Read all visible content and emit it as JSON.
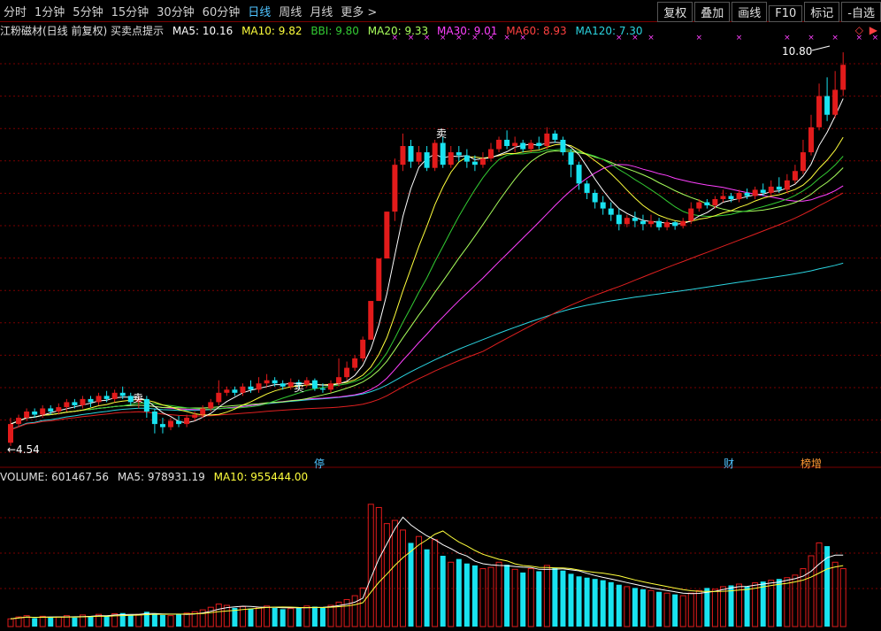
{
  "toolbar": {
    "periods": [
      "分时",
      "1分钟",
      "5分钟",
      "15分钟",
      "30分钟",
      "60分钟",
      "日线",
      "周线",
      "月线",
      "更多 >"
    ],
    "active_period": "日线",
    "buttons": [
      "复权",
      "叠加",
      "画线",
      "F10",
      "标记",
      "-自选"
    ]
  },
  "info": {
    "title": "江粉磁材(日线 前复权) 买卖点提示",
    "ma5": "MA5: 10.16",
    "ma10": "MA10: 9.82",
    "bbi": "BBI: 9.80",
    "ma20": "MA20: 9.33",
    "ma30": "MA30: 9.01",
    "ma60": "MA60: 8.93",
    "ma120": "MA120: 7.30"
  },
  "volume_info": {
    "volume": "VOLUME: 601467.56",
    "ma5": "MA5: 978931.19",
    "ma10": "MA10: 955444.00"
  },
  "colors": {
    "up": "#e21b1b",
    "down": "#19e3f0",
    "ma5": "#ffffff",
    "ma10": "#ffff3c",
    "bbi": "#33cc33",
    "ma20": "#a8ff5c",
    "ma30": "#ff40ff",
    "ma60": "#e02020",
    "ma120": "#2bd4e0",
    "grid": "#7a0000",
    "marker": "#ff40ff"
  },
  "markers": {
    "high_label": "10.80",
    "low_label": "4.54",
    "sell_labels": [
      "卖",
      "卖",
      "卖"
    ],
    "event_labels": [
      "停",
      "财",
      "榜增"
    ]
  },
  "chart_data": {
    "type": "candlestick",
    "title": "江粉磁材(日线 前复权)",
    "price_range": [
      4.2,
      11.0
    ],
    "high": 10.8,
    "low": 4.54,
    "candles": [
      [
        4.55,
        4.85,
        4.5,
        4.95
      ],
      [
        4.85,
        4.95,
        4.8,
        5.0
      ],
      [
        4.95,
        5.05,
        4.9,
        5.1
      ],
      [
        5.05,
        5.0,
        4.95,
        5.1
      ],
      [
        5.0,
        5.1,
        4.95,
        5.15
      ],
      [
        5.1,
        5.05,
        5.0,
        5.15
      ],
      [
        5.05,
        5.12,
        5.0,
        5.18
      ],
      [
        5.12,
        5.2,
        5.05,
        5.25
      ],
      [
        5.2,
        5.15,
        5.1,
        5.25
      ],
      [
        5.15,
        5.25,
        5.1,
        5.3
      ],
      [
        5.25,
        5.2,
        5.12,
        5.3
      ],
      [
        5.2,
        5.3,
        5.15,
        5.35
      ],
      [
        5.3,
        5.25,
        5.2,
        5.38
      ],
      [
        5.25,
        5.35,
        5.2,
        5.4
      ],
      [
        5.35,
        5.3,
        5.25,
        5.45
      ],
      [
        5.3,
        5.2,
        5.15,
        5.35
      ],
      [
        5.2,
        5.25,
        5.1,
        5.3
      ],
      [
        5.25,
        5.05,
        4.95,
        5.3
      ],
      [
        5.05,
        4.85,
        4.7,
        5.1
      ],
      [
        4.85,
        4.8,
        4.7,
        4.95
      ],
      [
        4.8,
        4.9,
        4.75,
        4.95
      ],
      [
        4.9,
        4.85,
        4.8,
        4.98
      ],
      [
        4.85,
        4.95,
        4.8,
        5.0
      ],
      [
        4.95,
        5.0,
        4.9,
        5.05
      ],
      [
        5.0,
        5.1,
        4.95,
        5.15
      ],
      [
        5.1,
        5.2,
        5.05,
        5.25
      ],
      [
        5.2,
        5.35,
        5.15,
        5.55
      ],
      [
        5.35,
        5.4,
        5.3,
        5.45
      ],
      [
        5.4,
        5.35,
        5.3,
        5.45
      ],
      [
        5.35,
        5.45,
        5.3,
        5.5
      ],
      [
        5.45,
        5.4,
        5.35,
        5.55
      ],
      [
        5.4,
        5.5,
        5.35,
        5.6
      ],
      [
        5.5,
        5.55,
        5.45,
        5.65
      ],
      [
        5.55,
        5.5,
        5.45,
        5.6
      ],
      [
        5.5,
        5.45,
        5.4,
        5.55
      ],
      [
        5.45,
        5.52,
        5.4,
        5.58
      ],
      [
        5.52,
        5.48,
        5.42,
        5.56
      ],
      [
        5.48,
        5.55,
        5.44,
        5.6
      ],
      [
        5.55,
        5.42,
        5.38,
        5.58
      ],
      [
        5.42,
        5.4,
        5.35,
        5.5
      ],
      [
        5.4,
        5.5,
        5.35,
        5.55
      ],
      [
        5.5,
        5.6,
        5.45,
        5.9
      ],
      [
        5.6,
        5.75,
        5.55,
        5.85
      ],
      [
        5.75,
        5.9,
        5.7,
        5.95
      ],
      [
        5.9,
        6.2,
        5.85,
        6.25
      ],
      [
        6.2,
        6.82,
        6.2,
        6.82
      ],
      [
        6.82,
        7.5,
        6.82,
        7.5
      ],
      [
        7.5,
        8.25,
        7.5,
        8.25
      ],
      [
        8.25,
        9.0,
        8.1,
        9.1
      ],
      [
        9.0,
        9.3,
        8.9,
        9.5
      ],
      [
        9.3,
        9.05,
        8.95,
        9.4
      ],
      [
        9.05,
        9.2,
        9.0,
        9.3
      ],
      [
        9.2,
        8.95,
        8.9,
        9.3
      ],
      [
        8.95,
        9.35,
        8.9,
        9.4
      ],
      [
        9.35,
        9.0,
        8.95,
        9.45
      ],
      [
        9.0,
        9.2,
        8.95,
        9.3
      ],
      [
        9.2,
        9.15,
        9.05,
        9.3
      ],
      [
        9.15,
        9.05,
        8.95,
        9.25
      ],
      [
        9.05,
        9.0,
        8.9,
        9.15
      ],
      [
        9.0,
        9.1,
        8.95,
        9.2
      ],
      [
        9.1,
        9.25,
        9.05,
        9.35
      ],
      [
        9.25,
        9.4,
        9.2,
        9.45
      ],
      [
        9.4,
        9.3,
        9.25,
        9.55
      ],
      [
        9.3,
        9.35,
        9.2,
        9.45
      ],
      [
        9.35,
        9.25,
        9.2,
        9.4
      ],
      [
        9.25,
        9.35,
        9.2,
        9.4
      ],
      [
        9.35,
        9.3,
        9.25,
        9.45
      ],
      [
        9.3,
        9.5,
        9.25,
        9.6
      ],
      [
        9.5,
        9.4,
        9.35,
        9.55
      ],
      [
        9.4,
        9.2,
        9.15,
        9.45
      ],
      [
        9.2,
        9.0,
        8.8,
        9.25
      ],
      [
        9.0,
        8.7,
        8.6,
        9.05
      ],
      [
        8.7,
        8.55,
        8.45,
        8.75
      ],
      [
        8.55,
        8.4,
        8.3,
        8.6
      ],
      [
        8.4,
        8.3,
        8.2,
        8.5
      ],
      [
        8.3,
        8.2,
        8.1,
        8.4
      ],
      [
        8.2,
        8.05,
        7.95,
        8.3
      ],
      [
        8.05,
        8.15,
        8.0,
        8.2
      ],
      [
        8.15,
        8.1,
        8.0,
        8.25
      ],
      [
        8.1,
        8.05,
        7.95,
        8.2
      ],
      [
        8.05,
        8.1,
        8.0,
        8.2
      ],
      [
        8.1,
        8.0,
        7.95,
        8.15
      ],
      [
        8.0,
        8.08,
        7.95,
        8.12
      ],
      [
        8.08,
        8.02,
        7.96,
        8.1
      ],
      [
        8.02,
        8.1,
        7.98,
        8.15
      ],
      [
        8.1,
        8.3,
        8.05,
        8.4
      ],
      [
        8.3,
        8.4,
        8.25,
        8.45
      ],
      [
        8.4,
        8.35,
        8.3,
        8.45
      ],
      [
        8.35,
        8.45,
        8.3,
        8.5
      ],
      [
        8.45,
        8.5,
        8.4,
        8.6
      ],
      [
        8.5,
        8.45,
        8.4,
        8.55
      ],
      [
        8.45,
        8.55,
        8.4,
        8.6
      ],
      [
        8.55,
        8.5,
        8.45,
        8.62
      ],
      [
        8.5,
        8.6,
        8.45,
        8.65
      ],
      [
        8.6,
        8.55,
        8.5,
        8.7
      ],
      [
        8.55,
        8.65,
        8.5,
        8.75
      ],
      [
        8.65,
        8.6,
        8.55,
        8.8
      ],
      [
        8.6,
        8.75,
        8.55,
        8.85
      ],
      [
        8.75,
        8.9,
        8.7,
        9.0
      ],
      [
        8.9,
        9.2,
        8.85,
        9.4
      ],
      [
        9.2,
        9.6,
        9.15,
        9.8
      ],
      [
        9.6,
        10.1,
        9.55,
        10.3
      ],
      [
        10.1,
        9.8,
        9.7,
        10.4
      ],
      [
        9.8,
        10.2,
        9.75,
        10.5
      ],
      [
        10.2,
        10.6,
        10.1,
        10.8
      ]
    ],
    "volume_range": [
      0,
      2200000
    ],
    "volumes": [
      120,
      150,
      170,
      130,
      160,
      140,
      150,
      170,
      140,
      180,
      160,
      190,
      170,
      200,
      210,
      180,
      190,
      230,
      200,
      180,
      170,
      190,
      210,
      230,
      260,
      300,
      350,
      330,
      290,
      310,
      280,
      300,
      320,
      290,
      270,
      280,
      300,
      320,
      310,
      290,
      330,
      380,
      420,
      480,
      600,
      1900,
      1850,
      1600,
      1650,
      1500,
      1300,
      1400,
      1200,
      1350,
      1100,
      1000,
      1050,
      980,
      950,
      900,
      920,
      1000,
      960,
      890,
      840,
      900,
      860,
      950,
      910,
      870,
      820,
      780,
      760,
      740,
      720,
      690,
      650,
      620,
      600,
      580,
      560,
      540,
      520,
      500,
      480,
      520,
      560,
      600,
      580,
      620,
      640,
      660,
      620,
      680,
      700,
      720,
      740,
      760,
      800,
      900,
      1100,
      1300,
      1250,
      1000,
      900
    ],
    "volume_label": "VOLUME: 601467.56",
    "ma_series": [
      "MA5",
      "MA10",
      "BBI",
      "MA20",
      "MA30",
      "MA60",
      "MA120"
    ]
  }
}
